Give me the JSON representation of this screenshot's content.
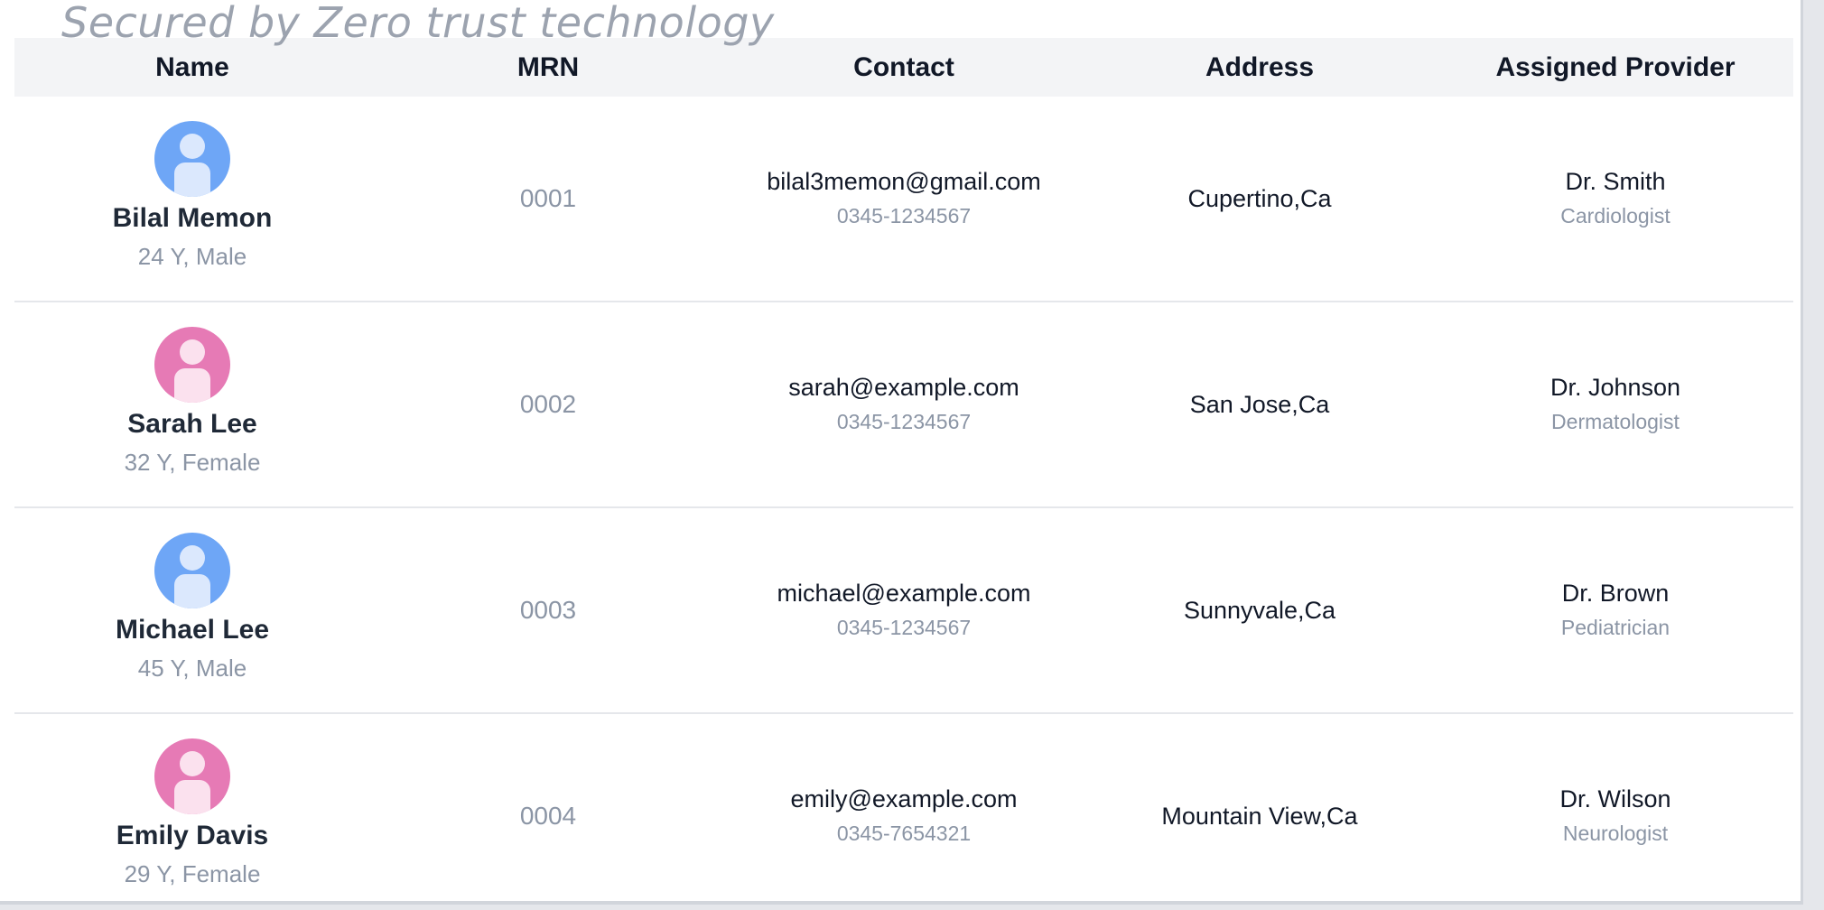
{
  "banner": {
    "caption": "Secured by Zero trust technology"
  },
  "table": {
    "columns": [
      "Name",
      "MRN",
      "Contact",
      "Address",
      "Assigned Provider"
    ],
    "rows": [
      {
        "name": "Bilal Memon",
        "meta": "24 Y, Male",
        "gender": "male",
        "mrn": "0001",
        "email": "bilal3memon@gmail.com",
        "phone": "0345-1234567",
        "address": "Cupertino,Ca",
        "provider": "Dr. Smith",
        "specialty": "Cardiologist"
      },
      {
        "name": "Sarah Lee",
        "meta": "32 Y, Female",
        "gender": "female",
        "mrn": "0002",
        "email": "sarah@example.com",
        "phone": "0345-1234567",
        "address": "San Jose,Ca",
        "provider": "Dr. Johnson",
        "specialty": "Dermatologist"
      },
      {
        "name": "Michael Lee",
        "meta": "45 Y, Male",
        "gender": "male",
        "mrn": "0003",
        "email": "michael@example.com",
        "phone": "0345-1234567",
        "address": "Sunnyvale,Ca",
        "provider": "Dr. Brown",
        "specialty": "Pediatrician"
      },
      {
        "name": "Emily Davis",
        "meta": "29 Y, Female",
        "gender": "female",
        "mrn": "0004",
        "email": "emily@example.com",
        "phone": "0345-7654321",
        "address": "Mountain View,Ca",
        "provider": "Dr. Wilson",
        "specialty": "Neurologist"
      }
    ]
  },
  "colors": {
    "male_avatar": "#6ea6f6",
    "female_avatar": "#e67ab5",
    "header_bg": "#f3f4f6",
    "muted_text": "#8b95a5"
  },
  "icons": {
    "avatar": "user-avatar-icon"
  }
}
